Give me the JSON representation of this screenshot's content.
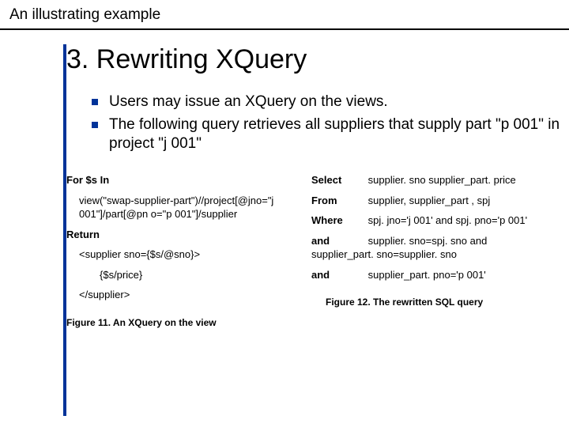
{
  "header": "An illustrating example",
  "title": "3. Rewriting XQuery",
  "bullets": [
    "Users may issue an XQuery on the views.",
    "The following query retrieves all suppliers that supply part \"p 001\" in project \"j 001\""
  ],
  "left": {
    "l1": "For $s In",
    "l2": "view(\"swap-supplier-part\")//project[@jno=\"j 001\"]/part[@pn o=\"p 001\"]/supplier",
    "l3": "Return",
    "l4": "<supplier sno={$s/@sno}>",
    "l5": "{$s/price}",
    "l6": "</supplier>",
    "caption": "Figure 11. An XQuery on the view"
  },
  "right": {
    "r1a": "Select",
    "r1b": "supplier. sno supplier_part. price",
    "r2a": "From",
    "r2b": "supplier, supplier_part , spj",
    "r3a": "Where",
    "r3b": "spj. jno='j 001' and spj. pno='p 001'",
    "r4a": "and",
    "r4b": "supplier. sno=spj. sno and supplier_part. sno=supplier. sno",
    "r5a": "and",
    "r5b": "supplier_part. pno='p 001'",
    "caption": "Figure 12. The rewritten SQL query"
  }
}
